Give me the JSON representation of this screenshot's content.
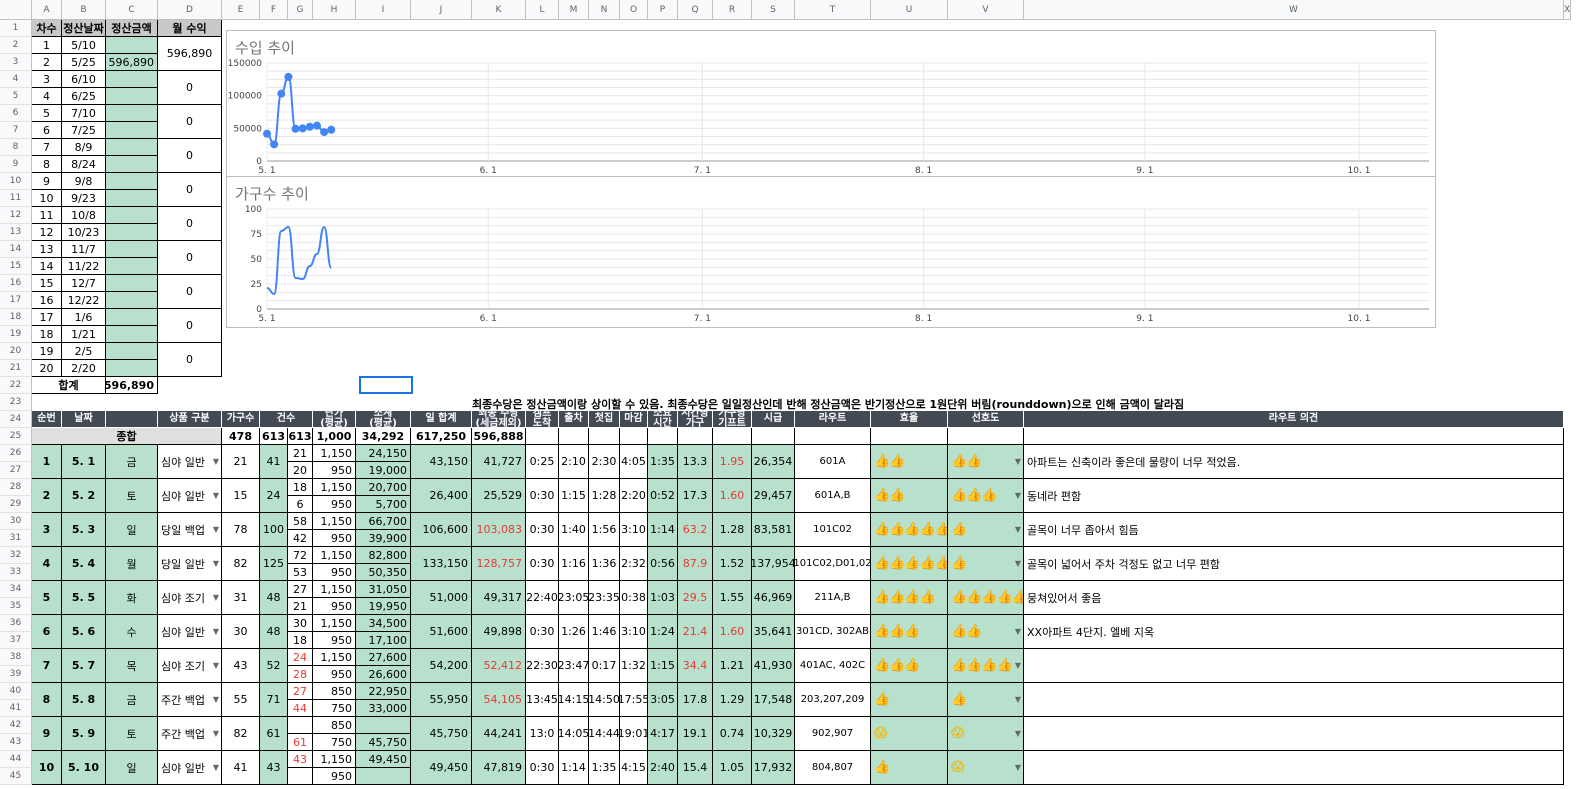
{
  "columns": [
    "A",
    "B",
    "C",
    "D",
    "E",
    "F",
    "G",
    "H",
    "I",
    "J",
    "K",
    "L",
    "M",
    "N",
    "O",
    "P",
    "Q",
    "R",
    "S",
    "T",
    "U",
    "V",
    "W",
    "X"
  ],
  "row_numbers": [
    "1",
    "2",
    "3",
    "4",
    "5",
    "6",
    "7",
    "8",
    "9",
    "10",
    "11",
    "12",
    "13",
    "14",
    "15",
    "16",
    "17",
    "18",
    "19",
    "20",
    "21",
    "22",
    "23",
    "24",
    "25",
    "26",
    "27",
    "28",
    "29",
    "30",
    "31",
    "32",
    "33",
    "34",
    "35",
    "36",
    "37",
    "38",
    "39",
    "40",
    "41",
    "42",
    "43",
    "44",
    "45"
  ],
  "settle": {
    "headers": [
      "차수",
      "정산날짜",
      "정산금액",
      "월 수익"
    ],
    "rows": [
      {
        "n": "1",
        "date": "5/10",
        "amount": ""
      },
      {
        "n": "2",
        "date": "5/25",
        "amount": "596,890"
      },
      {
        "n": "3",
        "date": "6/10",
        "amount": ""
      },
      {
        "n": "4",
        "date": "6/25",
        "amount": ""
      },
      {
        "n": "5",
        "date": "7/10",
        "amount": ""
      },
      {
        "n": "6",
        "date": "7/25",
        "amount": ""
      },
      {
        "n": "7",
        "date": "8/9",
        "amount": ""
      },
      {
        "n": "8",
        "date": "8/24",
        "amount": ""
      },
      {
        "n": "9",
        "date": "9/8",
        "amount": ""
      },
      {
        "n": "10",
        "date": "9/23",
        "amount": ""
      },
      {
        "n": "11",
        "date": "10/8",
        "amount": ""
      },
      {
        "n": "12",
        "date": "10/23",
        "amount": ""
      },
      {
        "n": "13",
        "date": "11/7",
        "amount": ""
      },
      {
        "n": "14",
        "date": "11/22",
        "amount": ""
      },
      {
        "n": "15",
        "date": "12/7",
        "amount": ""
      },
      {
        "n": "16",
        "date": "12/22",
        "amount": ""
      },
      {
        "n": "17",
        "date": "1/6",
        "amount": ""
      },
      {
        "n": "18",
        "date": "1/21",
        "amount": ""
      },
      {
        "n": "19",
        "date": "2/5",
        "amount": ""
      },
      {
        "n": "20",
        "date": "2/20",
        "amount": ""
      }
    ],
    "monthly": [
      "596,890",
      "0",
      "0",
      "0",
      "0",
      "0",
      "0",
      "0",
      "0",
      "0"
    ],
    "total_label": "합계",
    "total_value": "596,890"
  },
  "chart_data": [
    {
      "type": "line",
      "title": "수입 추이",
      "xlabel": "",
      "ylabel": "",
      "x_ticks": [
        "5. 1",
        "6. 1",
        "7. 1",
        "8. 1",
        "9. 1",
        "10. 1"
      ],
      "y_ticks": [
        "0",
        "50000",
        "100000",
        "150000"
      ],
      "ylim": [
        0,
        150000
      ],
      "x": [
        "5/1",
        "5/2",
        "5/3",
        "5/4",
        "5/5",
        "5/6",
        "5/7",
        "5/8",
        "5/9",
        "5/10"
      ],
      "series": [
        {
          "values": [
            41727,
            25529,
            103083,
            128757,
            49317,
            49898,
            52412,
            54105,
            44241,
            47819
          ]
        }
      ],
      "grid": true,
      "color": "#4285f4"
    },
    {
      "type": "line",
      "title": "가구수 추이",
      "xlabel": "",
      "ylabel": "",
      "x_ticks": [
        "5. 1",
        "6. 1",
        "7. 1",
        "8. 1",
        "9. 1",
        "10. 1"
      ],
      "y_ticks": [
        "0",
        "25",
        "50",
        "75",
        "100"
      ],
      "ylim": [
        0,
        100
      ],
      "x": [
        "5/1",
        "5/2",
        "5/3",
        "5/4",
        "5/5",
        "5/6",
        "5/7",
        "5/8",
        "5/9",
        "5/10"
      ],
      "series": [
        {
          "values": [
            21,
            15,
            78,
            82,
            31,
            30,
            43,
            55,
            82,
            41
          ]
        }
      ],
      "grid": true,
      "color": "#4285f4"
    }
  ],
  "note": "최종수당은 정산금액이랑 상이할 수 있음. 최종수당은 일일정산인데 반해 정산금액은 반기정산으로 1원단위 버림(rounddown)으로 인해 금액이 달라짐",
  "main": {
    "headers": [
      "순번",
      "날짜",
      "",
      "상품 구분",
      "가구수",
      "건수",
      "단가\n(평균)",
      "소계\n(평균)",
      "일 합계",
      "최종 수당\n(세금제외)",
      "캠프\n도착",
      "출차",
      "첫집",
      "마감",
      "소요\n시간",
      "시간당\n가구",
      "가구당\n기프트",
      "시급",
      "라우트",
      "효율",
      "선호도",
      "라우트 의견"
    ],
    "total": {
      "label": "종합",
      "households": "478",
      "count1": "613",
      "count2": "613",
      "unit": "1,000",
      "subtotal": "34,292",
      "day_total": "617,250",
      "final": "596,888"
    },
    "rows": [
      {
        "no": "1",
        "date": "5. 1",
        "day": "금",
        "product": "심야 일반",
        "households": "21",
        "count": "41",
        "sub": [
          {
            "cnt": "21",
            "price": "1,150",
            "sum": "24,150"
          },
          {
            "cnt": "20",
            "price": "950",
            "sum": "19,000"
          }
        ],
        "day_total": "43,150",
        "final": "41,727",
        "camp": "0:25",
        "depart": "2:10",
        "first": "2:30",
        "end": "4:05",
        "duration": "1:35",
        "per_hour": "13.3",
        "gift": "1.95",
        "wage": "26,354",
        "route": "601A",
        "eff": "👍👍",
        "pref": "👍👍",
        "comment": "아파트는 신축이라 좋은데  물량이 너무 적었음."
      },
      {
        "no": "2",
        "date": "5. 2",
        "day": "토",
        "product": "심야 일반",
        "households": "15",
        "count": "24",
        "sub": [
          {
            "cnt": "18",
            "price": "1,150",
            "sum": "20,700"
          },
          {
            "cnt": "6",
            "price": "950",
            "sum": "5,700"
          }
        ],
        "day_total": "26,400",
        "final": "25,529",
        "camp": "0:30",
        "depart": "1:15",
        "first": "1:28",
        "end": "2:20",
        "duration": "0:52",
        "per_hour": "17.3",
        "gift": "1.60",
        "wage": "29,457",
        "route": "601A,B",
        "eff": "👍👍",
        "pref": "👍👍👍",
        "comment": "동네라 편함"
      },
      {
        "no": "3",
        "date": "5. 3",
        "day": "일",
        "product": "당일 백업",
        "households": "78",
        "count": "100",
        "sub": [
          {
            "cnt": "58",
            "price": "1,150",
            "sum": "66,700"
          },
          {
            "cnt": "42",
            "price": "950",
            "sum": "39,900"
          }
        ],
        "day_total": "106,600",
        "final": "103,083",
        "camp": "0:30",
        "depart": "1:40",
        "first": "1:56",
        "end": "3:10",
        "duration": "1:14",
        "per_hour": "63.2",
        "gift": "1.28",
        "wage": "83,581",
        "route": "101C02",
        "eff": "👍👍👍👍👍",
        "pref": "👍",
        "comment": "골목이 너무 좁아서 힘듬"
      },
      {
        "no": "4",
        "date": "5. 4",
        "day": "월",
        "product": "당일 일반",
        "households": "82",
        "count": "125",
        "sub": [
          {
            "cnt": "72",
            "price": "1,150",
            "sum": "82,800"
          },
          {
            "cnt": "53",
            "price": "950",
            "sum": "50,350"
          }
        ],
        "day_total": "133,150",
        "final": "128,757",
        "camp": "0:30",
        "depart": "1:16",
        "first": "1:36",
        "end": "2:32",
        "duration": "0:56",
        "per_hour": "87.9",
        "gift": "1.52",
        "wage": "137,954",
        "route": "101C02,D01,02",
        "eff": "👍👍👍👍👍",
        "pref": "👍",
        "comment": "골목이 넓어서 주차 걱정도 없고 너무 편함"
      },
      {
        "no": "5",
        "date": "5. 5",
        "day": "화",
        "product": "심야 조기",
        "households": "31",
        "count": "48",
        "sub": [
          {
            "cnt": "27",
            "price": "1,150",
            "sum": "31,050"
          },
          {
            "cnt": "21",
            "price": "950",
            "sum": "19,950"
          }
        ],
        "day_total": "51,000",
        "final": "49,317",
        "camp": "22:40",
        "depart": "23:05",
        "first": "23:35",
        "end": "0:38",
        "duration": "1:03",
        "per_hour": "29.5",
        "gift": "1.55",
        "wage": "46,969",
        "route": "211A,B",
        "eff": "👍👍👍👍",
        "pref": "👍👍👍👍👍",
        "comment": "뭉쳐있어서 좋음"
      },
      {
        "no": "6",
        "date": "5. 6",
        "day": "수",
        "product": "심야 일반",
        "households": "30",
        "count": "48",
        "sub": [
          {
            "cnt": "30",
            "price": "1,150",
            "sum": "34,500"
          },
          {
            "cnt": "18",
            "price": "950",
            "sum": "17,100"
          }
        ],
        "day_total": "51,600",
        "final": "49,898",
        "camp": "0:30",
        "depart": "1:26",
        "first": "1:46",
        "end": "3:10",
        "duration": "1:24",
        "per_hour": "21.4",
        "gift": "1.60",
        "wage": "35,641",
        "route": "301CD, 302AB",
        "eff": "👍👍👍",
        "pref": "👍👍",
        "comment": "XX아파트 4단지. 엘베 지옥"
      },
      {
        "no": "7",
        "date": "5. 7",
        "day": "목",
        "product": "심야 조기",
        "households": "43",
        "count": "52",
        "sub": [
          {
            "cnt": "24",
            "price": "1,150",
            "sum": "27,600"
          },
          {
            "cnt": "28",
            "price": "950",
            "sum": "26,600"
          }
        ],
        "day_total": "54,200",
        "final": "52,412",
        "camp": "22:30",
        "depart": "23:47",
        "first": "0:17",
        "end": "1:32",
        "duration": "1:15",
        "per_hour": "34.4",
        "gift": "1.21",
        "wage": "41,930",
        "route": "401AC, 402C",
        "eff": "👍👍👍",
        "pref": "👍👍👍👍",
        "comment": ""
      },
      {
        "no": "8",
        "date": "5. 8",
        "day": "금",
        "product": "주간 백업",
        "households": "55",
        "count": "71",
        "sub": [
          {
            "cnt": "27",
            "price": "850",
            "sum": "22,950"
          },
          {
            "cnt": "44",
            "price": "750",
            "sum": "33,000"
          }
        ],
        "day_total": "55,950",
        "final": "54,105",
        "camp": "13:45",
        "depart": "14:15",
        "first": "14:50",
        "end": "17:55",
        "duration": "3:05",
        "per_hour": "17.8",
        "gift": "1.29",
        "wage": "17,548",
        "route": "203,207,209",
        "eff": "👍",
        "pref": "👍",
        "comment": ""
      },
      {
        "no": "9",
        "date": "5. 9",
        "day": "토",
        "product": "주간 백업",
        "households": "82",
        "count": "61",
        "sub": [
          {
            "cnt": "",
            "price": "850",
            "sum": ""
          },
          {
            "cnt": "61",
            "price": "750",
            "sum": "45,750"
          }
        ],
        "day_total": "45,750",
        "final": "44,241",
        "camp": "13:0",
        "depart": "14:05",
        "first": "14:44",
        "end": "19:01",
        "duration": "4:17",
        "per_hour": "19.1",
        "gift": "0.74",
        "wage": "10,329",
        "route": "902,907",
        "eff": "😱",
        "pref": "😱",
        "comment": ""
      },
      {
        "no": "10",
        "date": "5. 10",
        "day": "일",
        "product": "심야 일반",
        "households": "41",
        "count": "43",
        "sub": [
          {
            "cnt": "43",
            "price": "1,150",
            "sum": "49,450"
          },
          {
            "cnt": "",
            "price": "950",
            "sum": ""
          }
        ],
        "day_total": "49,450",
        "final": "47,819",
        "camp": "0:30",
        "depart": "1:14",
        "first": "1:35",
        "end": "4:15",
        "duration": "2:40",
        "per_hour": "15.4",
        "gift": "1.05",
        "wage": "17,932",
        "route": "804,807",
        "eff": "👍",
        "pref": "😱",
        "comment": ""
      }
    ]
  }
}
